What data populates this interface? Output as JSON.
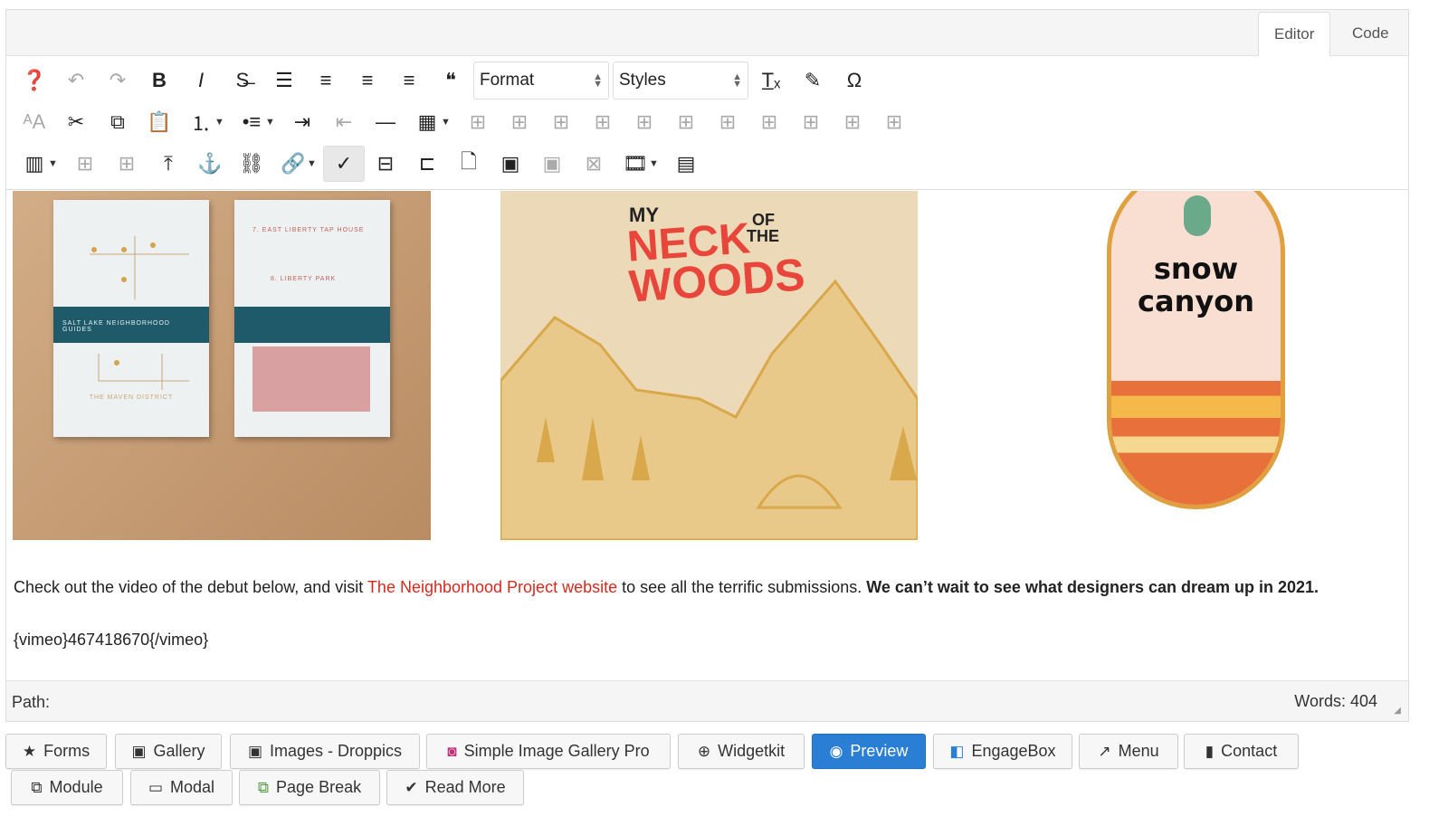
{
  "tabs": [
    {
      "label": "Editor",
      "active": true
    },
    {
      "label": "Code",
      "active": false
    }
  ],
  "toolbar": {
    "row1": [
      {
        "icon": "help-icon"
      },
      {
        "icon": "undo-icon",
        "disabled": true
      },
      {
        "icon": "redo-icon",
        "disabled": true
      },
      {
        "icon": "bold-icon"
      },
      {
        "icon": "italic-icon"
      },
      {
        "icon": "strikethrough-icon"
      },
      {
        "icon": "align-justify-icon"
      },
      {
        "icon": "align-center-icon"
      },
      {
        "icon": "align-left-icon"
      },
      {
        "icon": "align-right-icon"
      },
      {
        "icon": "blockquote-icon"
      }
    ],
    "format_select": "Format",
    "styles_select": "Styles",
    "row1b": [
      {
        "icon": "clear-formatting-icon"
      },
      {
        "icon": "cleanup-icon"
      },
      {
        "icon": "special-character-icon"
      }
    ],
    "row2": [
      {
        "icon": "font-size-icon",
        "disabled": true
      },
      {
        "icon": "cut-icon"
      },
      {
        "icon": "copy-icon"
      },
      {
        "icon": "paste-icon"
      },
      {
        "icon": "numbered-list-icon",
        "dropdown": true
      },
      {
        "icon": "bullet-list-icon",
        "dropdown": true
      },
      {
        "icon": "indent-icon"
      },
      {
        "icon": "outdent-icon",
        "disabled": true
      },
      {
        "icon": "horizontal-rule-icon"
      },
      {
        "icon": "table-icon",
        "dropdown": true
      },
      {
        "icon": "delete-table-icon",
        "disabled": true
      },
      {
        "icon": "row-props-icon",
        "disabled": true
      },
      {
        "icon": "cell-props-icon",
        "disabled": true
      },
      {
        "icon": "row-before-icon",
        "disabled": true
      },
      {
        "icon": "row-after-icon",
        "disabled": true
      },
      {
        "icon": "delete-row-icon",
        "disabled": true
      },
      {
        "icon": "col-before-icon",
        "disabled": true
      },
      {
        "icon": "col-after-icon",
        "disabled": true
      },
      {
        "icon": "delete-col-icon",
        "disabled": true
      },
      {
        "icon": "split-cells-icon",
        "disabled": true
      },
      {
        "icon": "merge-cells-icon",
        "disabled": true
      }
    ],
    "row3": [
      {
        "icon": "columns-icon",
        "dropdown": true
      },
      {
        "icon": "insert-column-icon",
        "disabled": true
      },
      {
        "icon": "delete-column-icon",
        "disabled": true
      },
      {
        "icon": "upload-icon"
      },
      {
        "icon": "anchor-icon"
      },
      {
        "icon": "unlink-icon"
      },
      {
        "icon": "link-icon",
        "dropdown": true
      },
      {
        "icon": "spellcheck-icon",
        "selected": true
      },
      {
        "icon": "page-break-icon"
      },
      {
        "icon": "readmore-icon"
      },
      {
        "icon": "file-icon"
      },
      {
        "icon": "image-icon"
      },
      {
        "icon": "image-manager-icon",
        "disabled": true
      },
      {
        "icon": "image-delete-icon",
        "disabled": true
      },
      {
        "icon": "media-icon",
        "dropdown": true
      },
      {
        "icon": "template-icon"
      }
    ]
  },
  "content": {
    "img2_title": [
      "MY",
      "NECK",
      "OF",
      "THE",
      "WOODS"
    ],
    "badge_text": [
      "snow",
      "canyon"
    ],
    "book1_band": "SALT LAKE NEIGHBORHOOD GUIDES",
    "book1_footer": "THE MAVEN DISTRICT",
    "book2_lines": [
      "7. EAST LIBERTY TAP HOUSE",
      "8. LIBERTY PARK"
    ],
    "para_before": "Check out the video of the debut below, and visit ",
    "para_link": "The Neighborhood Project website",
    "para_after": " to see all the terrific submissions. ",
    "para_bold": "We can’t wait to see what designers can dream up in 2021.",
    "vimeo": "{vimeo}467418670{/vimeo}"
  },
  "status": {
    "path_label": "Path:",
    "words": "Words: 404"
  },
  "buttons": [
    {
      "label": "Forms",
      "icon": "star-icon"
    },
    {
      "label": "Gallery",
      "icon": "picture-icon"
    },
    {
      "label": "Images - Droppics",
      "icon": "picture-icon"
    },
    {
      "label": "Simple Image Gallery Pro",
      "icon": "camera-icon"
    },
    {
      "label": "Widgetkit",
      "icon": "plus-circle-icon"
    },
    {
      "label": "Preview",
      "icon": "eye-icon",
      "primary": true
    },
    {
      "label": "EngageBox",
      "icon": "square-icon"
    },
    {
      "label": "Menu",
      "icon": "share-icon"
    },
    {
      "label": "Contact",
      "icon": "contact-icon"
    },
    {
      "label": "Module",
      "icon": "module-icon"
    },
    {
      "label": "Modal",
      "icon": "modal-icon"
    },
    {
      "label": "Page Break",
      "icon": "copy-icon"
    },
    {
      "label": "Read More",
      "icon": "chevron-down-icon"
    }
  ],
  "colors": {
    "accent": "#2a7fd4",
    "link": "#d52a1f"
  }
}
